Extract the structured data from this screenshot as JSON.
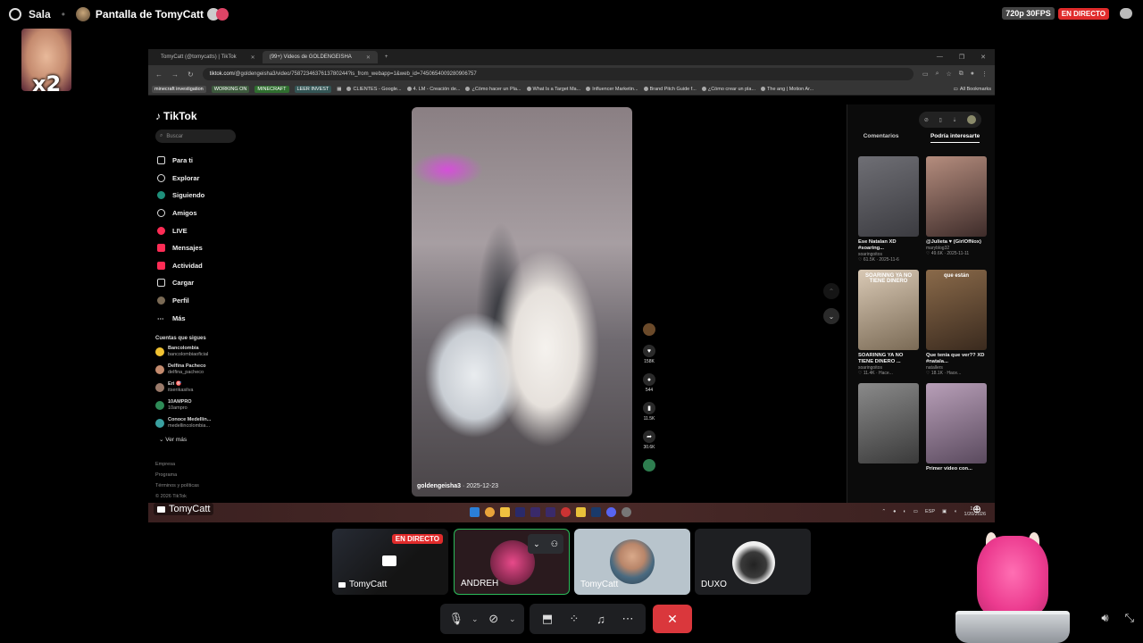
{
  "topbar": {
    "room": "Sala",
    "screen_title": "Pantalla de TomyCatt",
    "quality": "720p 30FPS",
    "live": "EN DIRECTO"
  },
  "face_overlay": {
    "multiplier": "x2"
  },
  "browser": {
    "tabs": [
      {
        "label": "TomyCatt (@tomycatts) | TikTok",
        "active": false
      },
      {
        "label": "(99+) Videos de GOLDENGEISHA",
        "active": true
      }
    ],
    "url_host": "tiktok.com",
    "url_path": "/@goldengeisha3/video/7587234637613780244?is_from_webapp=1&web_id=7450654009280906757",
    "bookmarks": [
      {
        "label": "minecraft investigation",
        "kind": "c1"
      },
      {
        "label": "WORKING ON",
        "kind": "c2"
      },
      {
        "label": "MINECRAFT",
        "kind": "c3"
      },
      {
        "label": "LEER INVEST",
        "kind": "c4"
      },
      {
        "label": "CLIENTES - Google...",
        "kind": "bm"
      },
      {
        "label": "4. LM - Creación de...",
        "kind": "bm"
      },
      {
        "label": "¿Cómo hacer un Pla...",
        "kind": "bm"
      },
      {
        "label": "What Is a Target Ma...",
        "kind": "bm"
      },
      {
        "label": "Influencer Marketin...",
        "kind": "bm"
      },
      {
        "label": "Brand Pitch Guide f...",
        "kind": "bm"
      },
      {
        "label": "¿Cómo crear un pla...",
        "kind": "bm"
      },
      {
        "label": "The ang | Motion Ar...",
        "kind": "bm"
      }
    ],
    "all_bookmarks": "All Bookmarks"
  },
  "tiktok": {
    "logo": "TikTok",
    "search_placeholder": "Buscar",
    "nav": [
      {
        "label": "Para ti",
        "icon": "home-icon"
      },
      {
        "label": "Explorar",
        "icon": "compass-icon"
      },
      {
        "label": "Siguiendo",
        "icon": "following-icon"
      },
      {
        "label": "Amigos",
        "icon": "friends-icon"
      },
      {
        "label": "LIVE",
        "icon": "live-icon"
      },
      {
        "label": "Mensajes",
        "icon": "messages-icon"
      },
      {
        "label": "Actividad",
        "icon": "activity-icon"
      },
      {
        "label": "Cargar",
        "icon": "upload-icon"
      },
      {
        "label": "Perfil",
        "icon": "profile-icon"
      },
      {
        "label": "Más",
        "icon": "more-icon"
      }
    ],
    "following_header": "Cuentas que sigues",
    "accounts": [
      {
        "name": "Bancolombia",
        "handle": "bancolombiaoficial"
      },
      {
        "name": "Delfina Pacheco",
        "handle": "delfina_pacheco"
      },
      {
        "name": "Eri 🎯",
        "handle": "itserikasilva"
      },
      {
        "name": "10AMPRO",
        "handle": "10ampro"
      },
      {
        "name": "Conoce Medellín...",
        "handle": "medellincolombia..."
      }
    ],
    "see_more": "Ver más",
    "footer": [
      "Empresa",
      "Programa",
      "Términos y políticas",
      "© 2026 TikTok"
    ],
    "video_author": "goldengeisha3",
    "video_date": "2025-12-23",
    "counts": {
      "likes": "158K",
      "comments": "544",
      "saves": "11.5K",
      "shares": "30.6K"
    },
    "right_tabs": [
      "Comentarios",
      "Podría interesarte"
    ],
    "cards": [
      {
        "title": "Ese Natalan XD #soaring...",
        "author": "soaringoitos",
        "meta": "♡ 61.5K · 2025-11-6",
        "overlay": "",
        "c1": "#6f6f75",
        "c2": "#3b3b40"
      },
      {
        "title": "@Julieta ♥ (GirlOfNox)",
        "author": "maryblog32",
        "meta": "♡ 49.6K · 2025-11-11",
        "overlay": "",
        "c1": "#b58d7e",
        "c2": "#3e2c2a"
      },
      {
        "title": "SOARINNG YA NO TIENE DINERO ...",
        "author": "soaringoitos",
        "meta": "♡ 11.4K · Hace...",
        "overlay": "SOARINNG YA NO TIENE DINERO",
        "c1": "#d9c9b5",
        "c2": "#7a6a55"
      },
      {
        "title": "Que tenía que ver?? XD #natala...",
        "author": "natallers",
        "meta": "♡ 18.1K · Hace...",
        "overlay": "que están",
        "c1": "#8a6a4a",
        "c2": "#3a2a1e"
      },
      {
        "title": "",
        "author": "",
        "meta": "",
        "overlay": "",
        "c1": "#8a8a8a",
        "c2": "#3a3a3a"
      },
      {
        "title": "Primer video con...",
        "author": "",
        "meta": "",
        "overlay": "",
        "c1": "#b89fb8",
        "c2": "#5a4a5e"
      }
    ]
  },
  "taskbar": {
    "lang": "ESP",
    "time": "1:20",
    "date": "1/20/2026"
  },
  "screen_owner": "TomyCatt",
  "participants": [
    {
      "name": "TomyCatt",
      "live": "EN DIRECTO"
    },
    {
      "name": "ANDREH"
    },
    {
      "name": "TomyCatt"
    },
    {
      "name": "DUXO"
    }
  ]
}
